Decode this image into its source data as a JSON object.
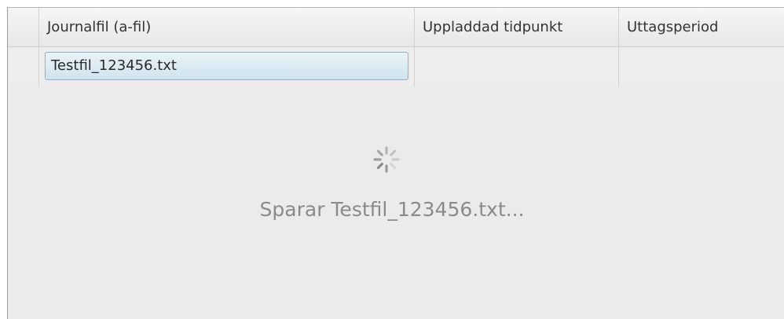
{
  "table": {
    "columns": [
      "",
      "Journalfil (a-fil)",
      "Uppladdad tidpunkt",
      "Uttagsperiod"
    ],
    "rows": [
      {
        "journalfil": "Testfil_123456.txt",
        "uppladdad": "",
        "uttagsperiod": ""
      }
    ]
  },
  "loading": {
    "icon": "spinner-icon",
    "message": "Sparar Testfil_123456.txt..."
  }
}
